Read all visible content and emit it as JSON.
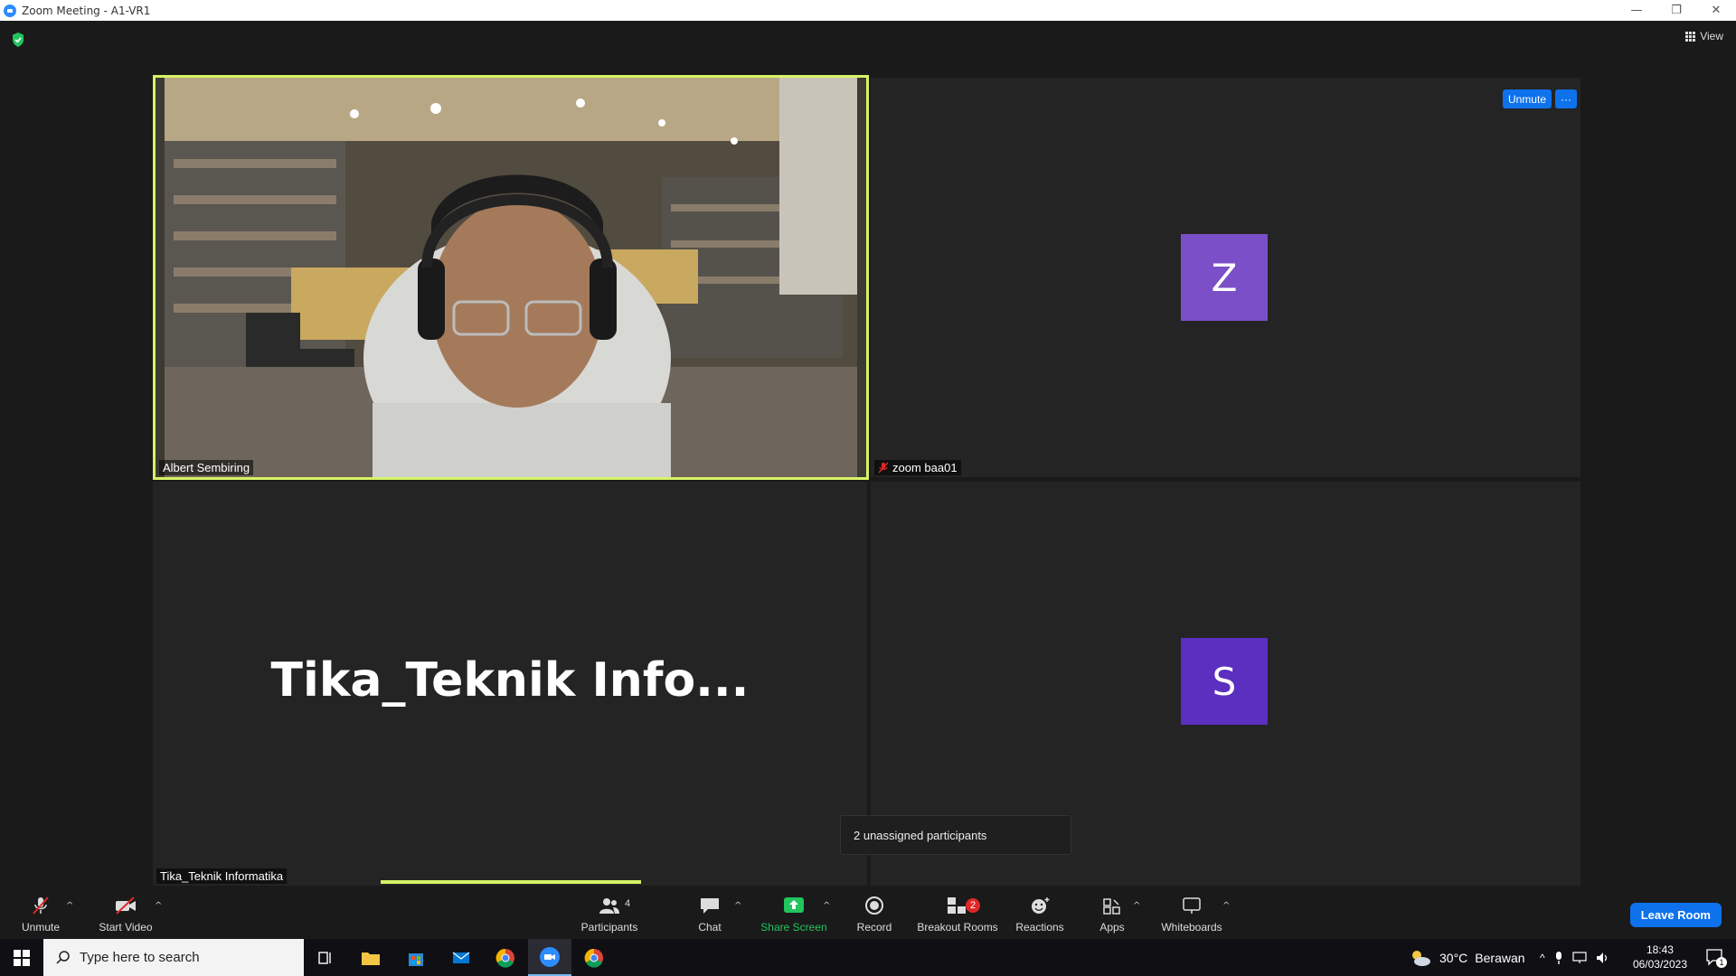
{
  "window": {
    "title": "Zoom Meeting - A1-VR1",
    "minimize": "—",
    "restore": "❐",
    "close": "✕"
  },
  "header": {
    "view_label": "View"
  },
  "tiles": {
    "albert": {
      "name": "Albert Sembiring"
    },
    "zoom_baa": {
      "name": "zoom baa01",
      "avatar_letter": "Z",
      "avatar_color": "#7b4fc7",
      "unmute_label": "Unmute",
      "more_label": "···"
    },
    "tika": {
      "name": "Tika_Teknik Informatika",
      "big_name": "Tika_Teknik  Info..."
    },
    "s_tile": {
      "avatar_letter": "S",
      "avatar_color": "#5b2fbf"
    }
  },
  "tooltip": {
    "text": "2 unassigned participants"
  },
  "toolbar": {
    "unmute": "Unmute",
    "start_video": "Start Video",
    "participants": "Participants",
    "participants_count": "4",
    "chat": "Chat",
    "share_screen": "Share Screen",
    "record": "Record",
    "breakout_rooms": "Breakout Rooms",
    "breakout_badge": "2",
    "reactions": "Reactions",
    "apps": "Apps",
    "whiteboards": "Whiteboards",
    "leave_room": "Leave Room",
    "caret": "^"
  },
  "taskbar": {
    "search_placeholder": "Type here to search",
    "weather_temp": "30°C",
    "weather_desc": "Berawan",
    "time": "18:43",
    "date": "06/03/2023",
    "notification_count": "1"
  },
  "colors": {
    "accent": "#0e72ed",
    "active_speaker": "#d7f266",
    "share_green": "#22c55e",
    "badge_red": "#e02828"
  }
}
